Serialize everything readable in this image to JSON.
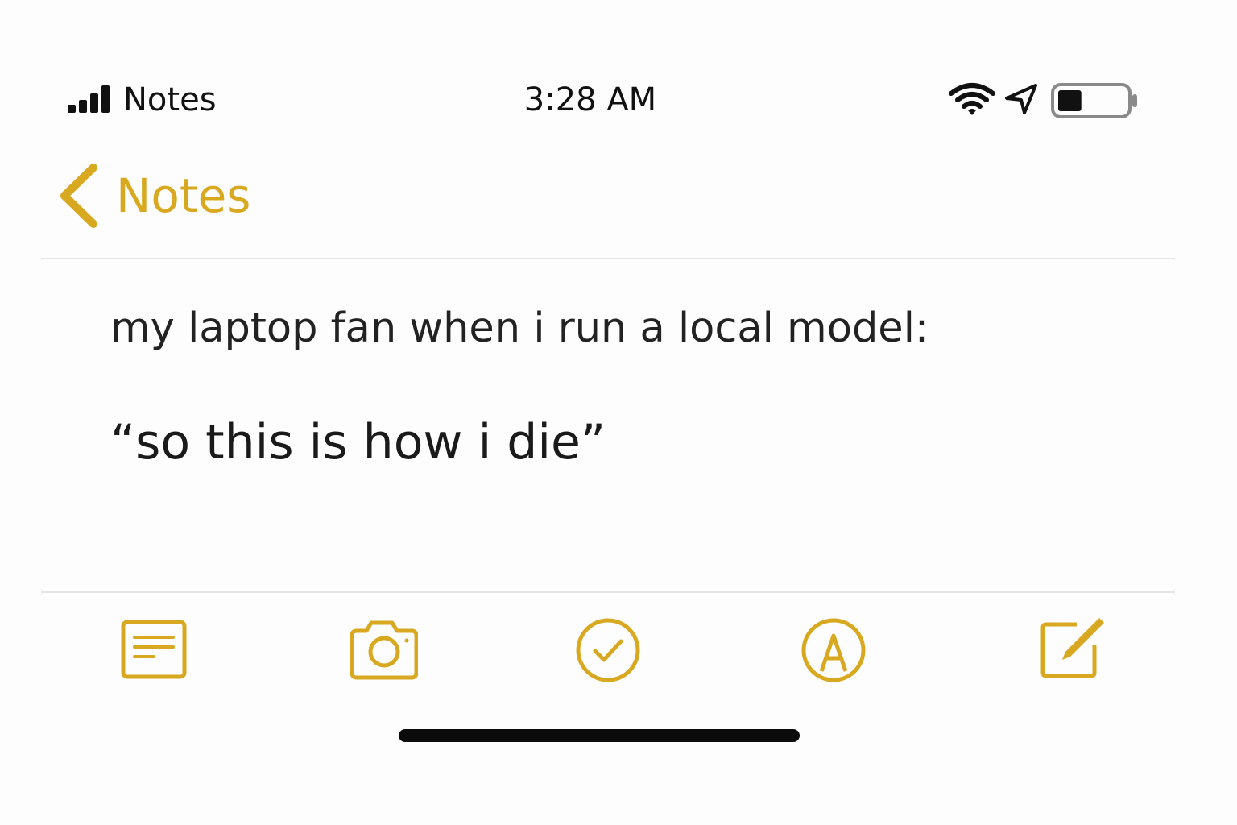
{
  "status_bar": {
    "carrier": "Notes",
    "time": "3:28 AM",
    "icons": [
      "signal-icon",
      "wifi-icon",
      "location-arrow-icon",
      "battery-icon"
    ],
    "battery_level": 0.35
  },
  "nav": {
    "back_label": "Notes",
    "back_icon": "chevron-left-icon"
  },
  "note": {
    "line1": "my laptop fan when i run a local model:",
    "line2": "“so this is how i die”"
  },
  "toolbar": {
    "items": [
      {
        "name": "checklist-format",
        "icon": "text-format-icon"
      },
      {
        "name": "camera",
        "icon": "camera-icon"
      },
      {
        "name": "checklist",
        "icon": "checkmark-circle-icon"
      },
      {
        "name": "markup",
        "icon": "markup-pen-icon"
      },
      {
        "name": "compose",
        "icon": "compose-icon"
      }
    ]
  },
  "colors": {
    "accent": "#d8a920",
    "text": "#1c1c1e",
    "background": "#fdfdfd",
    "divider": "#e6e6e6"
  }
}
